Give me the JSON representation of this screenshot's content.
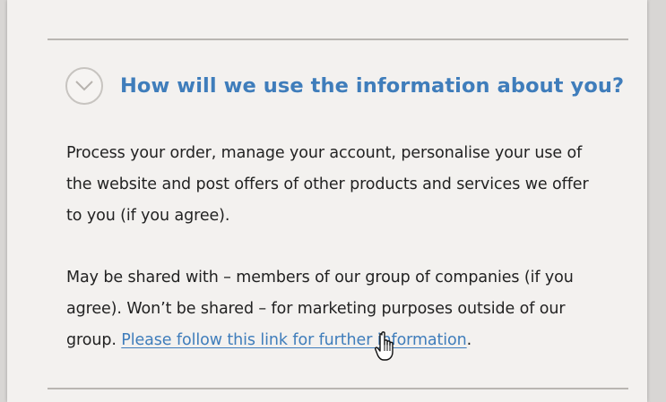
{
  "section": {
    "heading": "How will we use the information about you?",
    "toggle_icon": "chevron-down-icon",
    "paragraph1": "Process your order, manage your account, personalise your use of the website and post offers of other products and services we offer to you (if you agree).",
    "paragraph2_text": "May be shared with – members of our group of companies (if you agree). Won’t be shared – for marketing purposes outside of our group. ",
    "link_text": "Please follow this link for further information",
    "after_link": "."
  },
  "colors": {
    "heading": "#3f7dbb",
    "link": "#3f7dbb",
    "body_text": "#222222",
    "background": "#f3f1ef",
    "rule": "#b9b6b2"
  },
  "cursor_icon": "hand-pointer-icon"
}
